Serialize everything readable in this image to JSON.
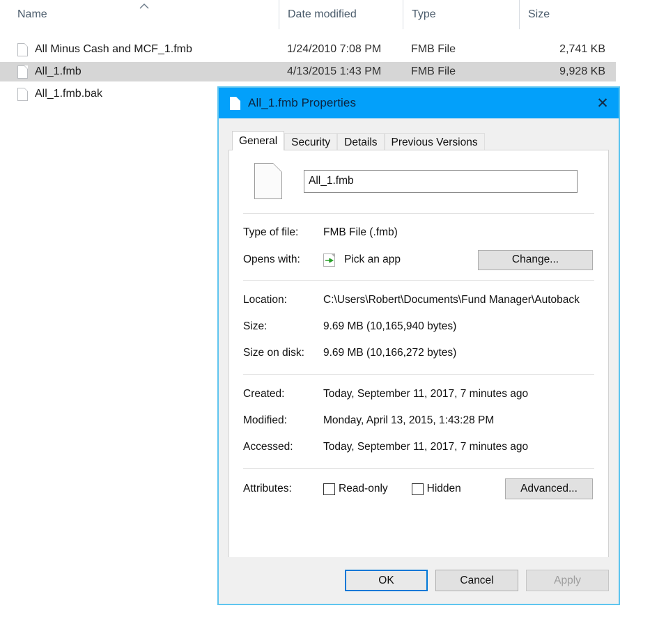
{
  "explorer": {
    "columns": [
      {
        "label": "Name",
        "sort_indicator": "ascending-chevron"
      },
      {
        "label": "Date modified"
      },
      {
        "label": "Type"
      },
      {
        "label": "Size"
      }
    ],
    "rows": [
      {
        "name": "All Minus Cash and MCF_1.fmb",
        "date_modified": "1/24/2010 7:08 PM",
        "type": "FMB File",
        "size": "2,741 KB",
        "selected": false
      },
      {
        "name": "All_1.fmb",
        "date_modified": "4/13/2015 1:43 PM",
        "type": "FMB File",
        "size": "9,928 KB",
        "selected": true
      },
      {
        "name": "All_1.fmb.bak",
        "date_modified": "",
        "type": "",
        "size": "",
        "selected": false
      }
    ]
  },
  "dialog": {
    "title": "All_1.fmb Properties",
    "close_label": "✕",
    "tabs": [
      {
        "label": "General",
        "active": true
      },
      {
        "label": "Security",
        "active": false
      },
      {
        "label": "Details",
        "active": false
      },
      {
        "label": "Previous Versions",
        "active": false
      }
    ],
    "filename_value": "All_1.fmb",
    "filename_placeholder": "File name",
    "properties": {
      "type_of_file_label": "Type of file:",
      "type_of_file_value": "FMB File (.fmb)",
      "opens_with_label": "Opens with:",
      "opens_with_value": "Pick an app",
      "change_button": "Change...",
      "location_label": "Location:",
      "location_value": "C:\\Users\\Robert\\Documents\\Fund Manager\\Autoback",
      "size_label": "Size:",
      "size_value": "9.69 MB (10,165,940 bytes)",
      "size_on_disk_label": "Size on disk:",
      "size_on_disk_value": "9.69 MB (10,166,272 bytes)",
      "created_label": "Created:",
      "created_value": "Today, September 11, 2017, 7 minutes ago",
      "modified_label": "Modified:",
      "modified_value": "Monday, April 13, 2015, 1:43:28 PM",
      "accessed_label": "Accessed:",
      "accessed_value": "Today, September 11, 2017, 7 minutes ago",
      "attributes_label": "Attributes:",
      "readonly_label": "Read-only",
      "readonly_checked": false,
      "hidden_label": "Hidden",
      "hidden_checked": false,
      "advanced_button": "Advanced..."
    },
    "footer": {
      "ok_label": "OK",
      "cancel_label": "Cancel",
      "apply_label": "Apply",
      "apply_enabled": false
    }
  },
  "colors": {
    "titlebar": "#03a0fa",
    "dialog_border": "#5fc5ef",
    "selection": "#d6d6d6",
    "focus_outline": "#0078d7",
    "app_arrow_green": "#2aa02a"
  }
}
